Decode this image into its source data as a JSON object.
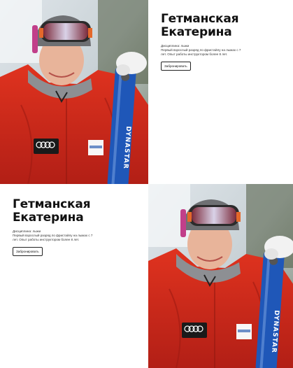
{
  "cards": [
    {
      "name_line1": "Гетманская",
      "name_line2": "Екатерина",
      "discipline": "Дисциплина: лыжи",
      "bio_line1": "Первый взрослый разряд по фристайлу на лыжах с 7",
      "bio_line2": "лет. Опыт работы инструктором более 8 лет.",
      "book_label": "Забронировать"
    },
    {
      "name_line1": "Гетманская",
      "name_line2": "Екатерина",
      "discipline": "Дисциплина: лыжи",
      "bio_line1": "Первый взрослый разряд по фристайлу на лыжах с 7",
      "bio_line2": "лет. Опыт работы инструктором более 8 лет.",
      "book_label": "Забронировать"
    }
  ],
  "photo": {
    "ski_brand": "DYNASTAR",
    "jacket_logo": "Audi",
    "colors": {
      "jacket": "#d42a1f",
      "ski": "#1f57b8",
      "goggles": "#c0392b",
      "background": "#e9ecef"
    }
  }
}
